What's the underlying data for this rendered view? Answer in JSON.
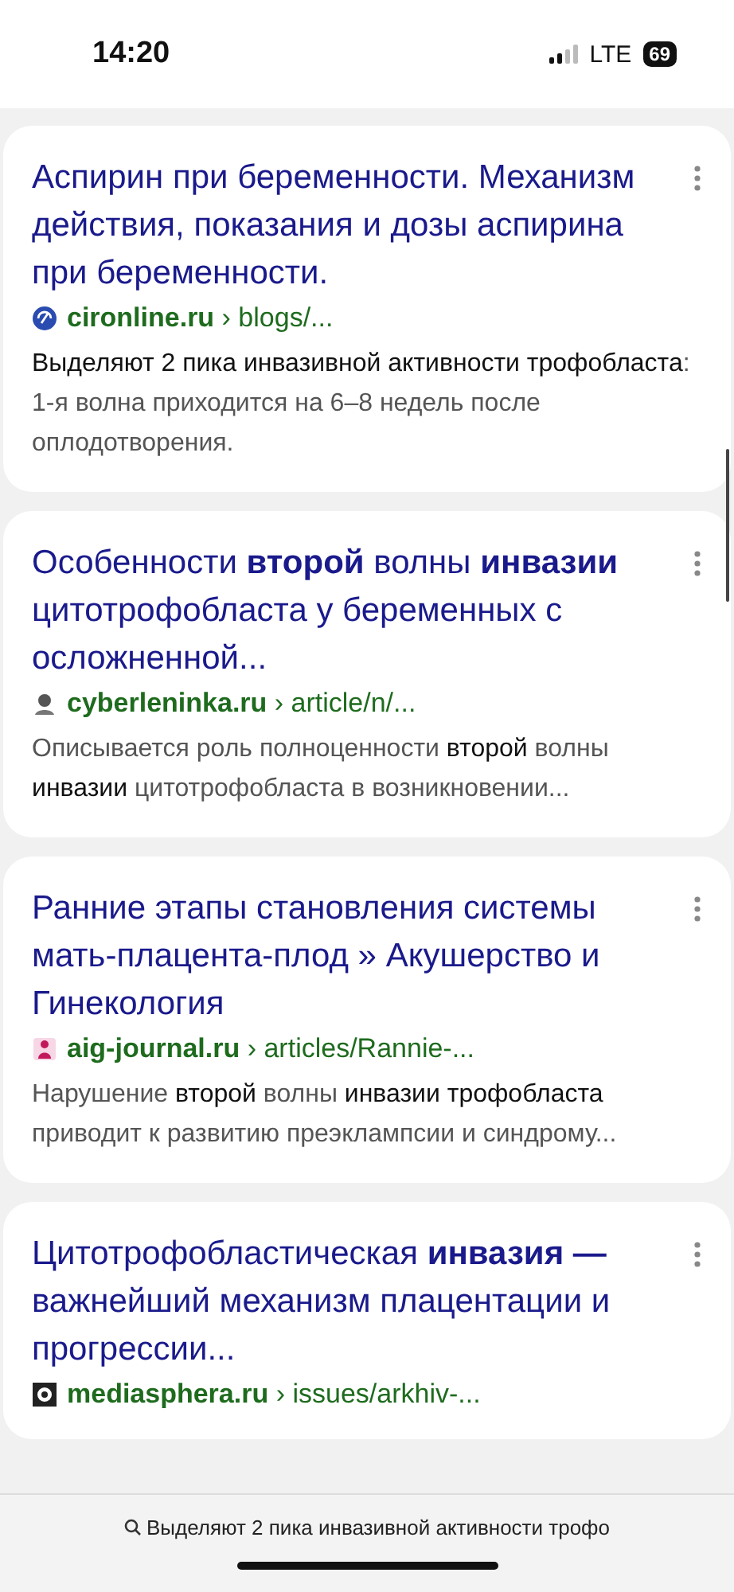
{
  "status_bar": {
    "time": "14:20",
    "network": "LTE",
    "battery": "69"
  },
  "results": [
    {
      "title": "Аспирин при беременности. Механизм действия, показания и дозы аспирина при беременности.",
      "site": "cironline.ru",
      "path": "› blogs/...",
      "kind": "circle",
      "snippet": "**Выделяют 2 пика инвазивной активности трофобласта**: 1-я волна приходится на 6–8 недель после оплодотворения."
    },
    {
      "title": "Особенности **второй** волны **инвазии** цитотрофобласта у беременных с осложненной...",
      "site": "cyberleninka.ru",
      "path": "› article/n/...",
      "kind": "bust",
      "snippet": "Описывается роль полноценности **второй** волны **инвазии** цитотрофобласта в возникновении..."
    },
    {
      "title": "Ранние этапы становления системы мать-плацента-плод » Акушерство и Гинекология",
      "site": "aig-journal.ru",
      "path": "› articles/Rannie-...",
      "kind": "figure",
      "snippet": "Нарушение **второй** волны **инвазии трофобласта** приводит к развитию преэклампсии и синдрому..."
    },
    {
      "title": "Цитотрофобластическая **инвазия —** важнейший механизм плацентации и прогрессии...",
      "site": "mediasphera.ru",
      "path": "› issues/arkhiv-...",
      "kind": "emblem"
    }
  ],
  "find_bar": {
    "query": "Выделяют 2 пика инвазивной активности трофо"
  }
}
